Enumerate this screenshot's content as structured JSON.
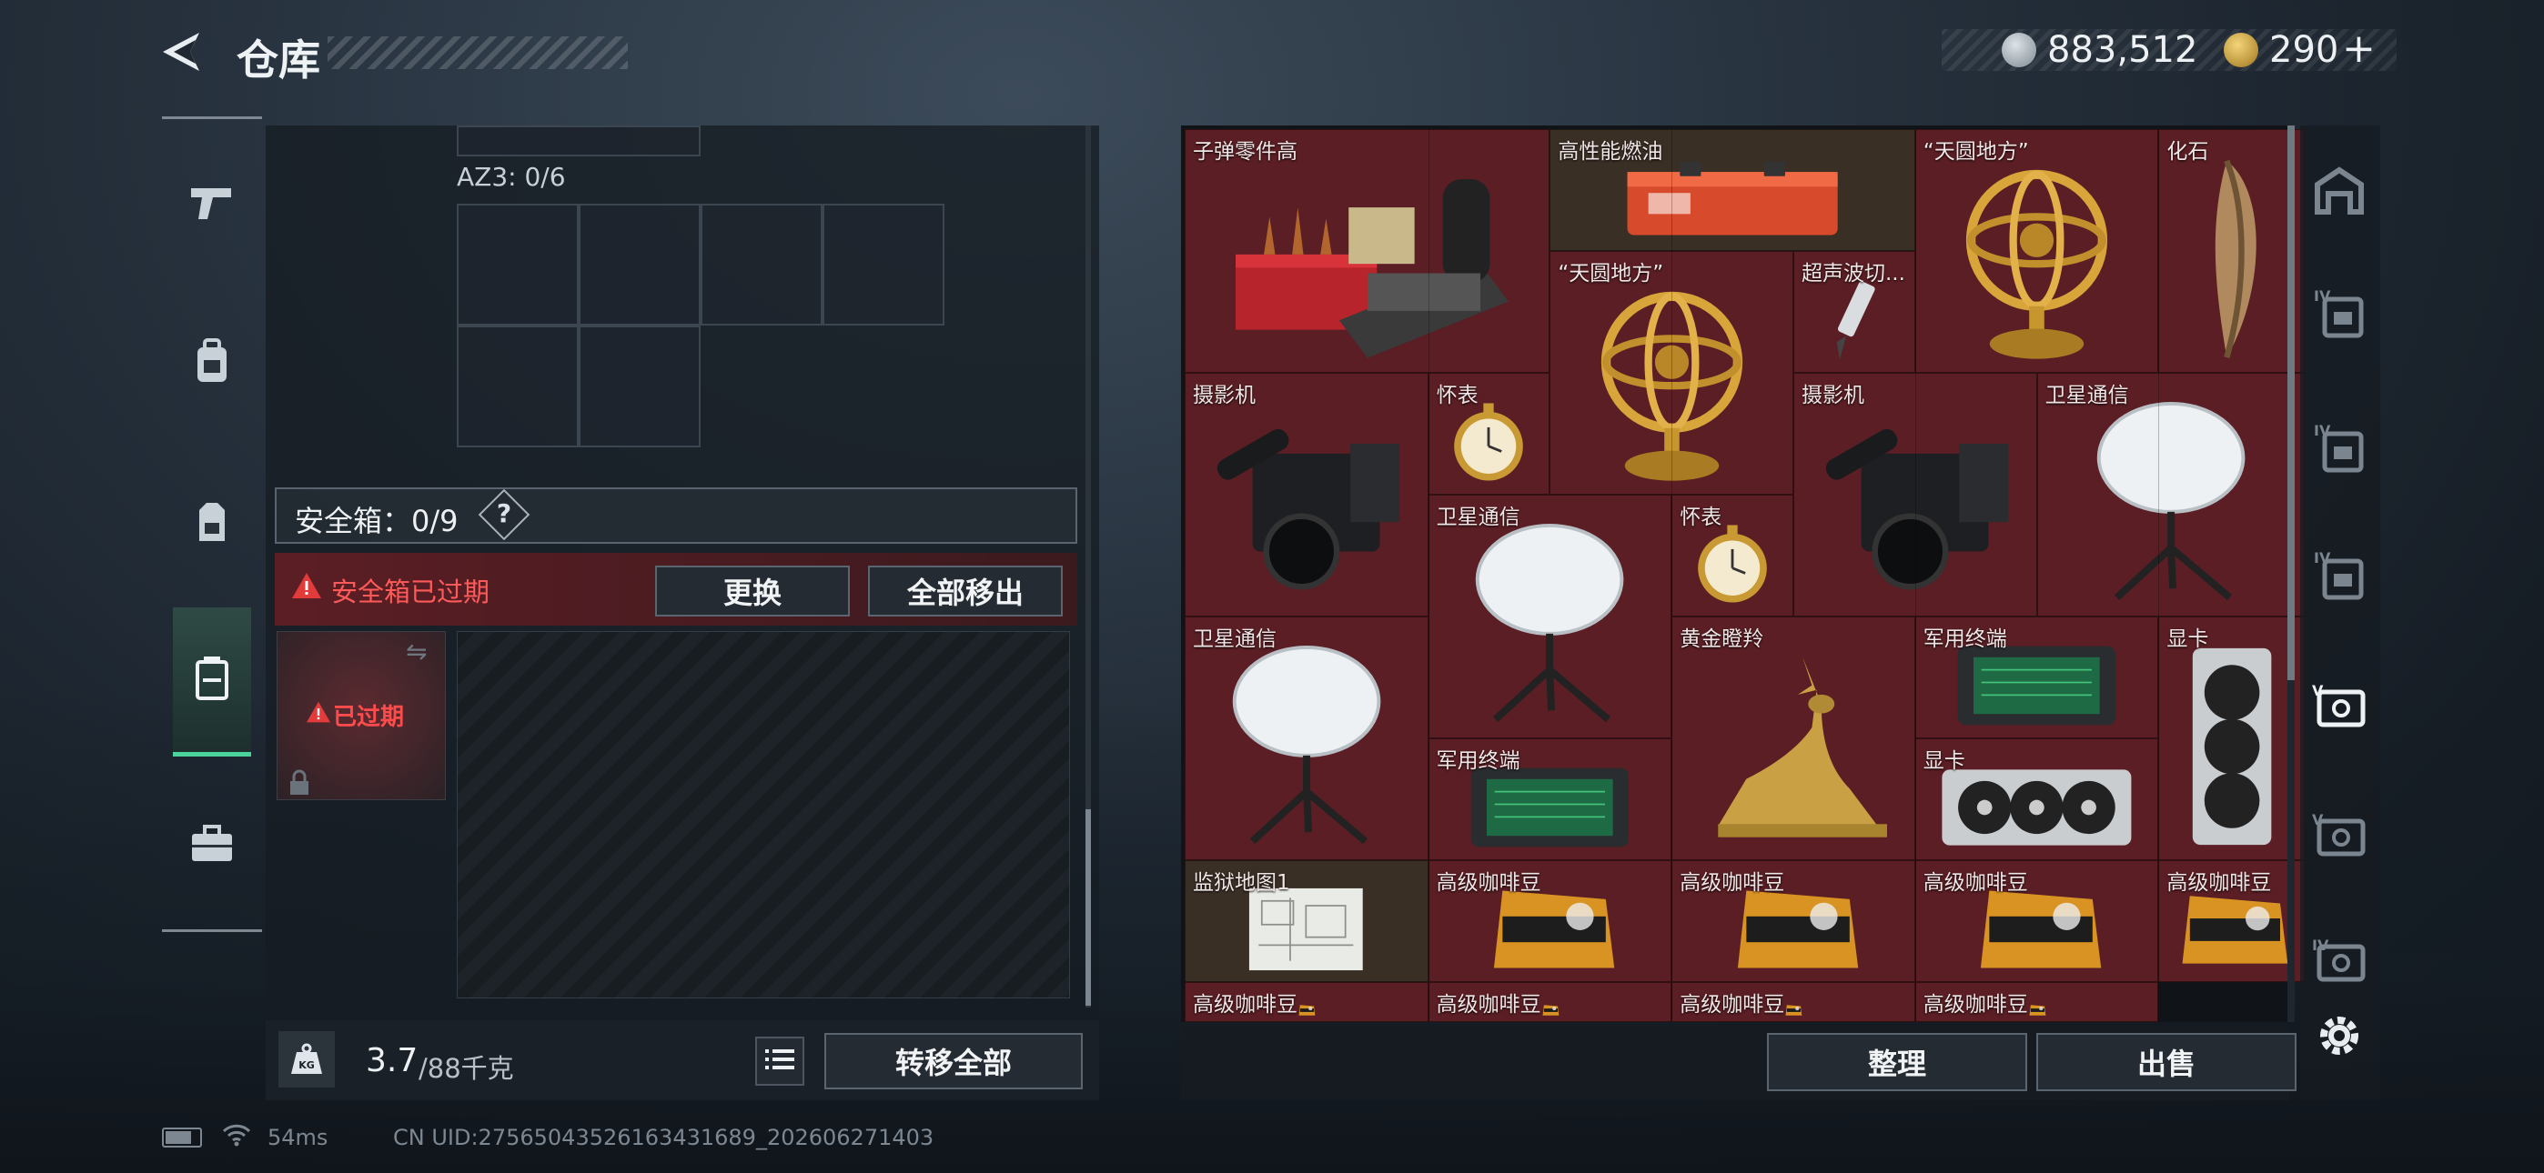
{
  "header": {
    "title": "仓库",
    "silver_amount": "883,512",
    "gold_amount": "290",
    "add_symbol": "+"
  },
  "left_nav": {
    "items": [
      "pistol-icon",
      "backpack-icon",
      "chest-rig-icon",
      "safe-box-icon",
      "toolbox-icon"
    ],
    "active": "safe-box-icon"
  },
  "rig": {
    "label": "AZ3: 0/6"
  },
  "safe_box": {
    "label": "安全箱：0/9",
    "help": "?",
    "warning": "安全箱已过期",
    "replace_label": "更换",
    "move_all_label": "全部移出",
    "expired_label": "已过期"
  },
  "weight": {
    "value": "3.7",
    "capacity": "/88千克"
  },
  "bottom_left": {
    "transfer_all_label": "转移全部"
  },
  "bottom_right": {
    "sort_label": "整理",
    "sell_label": "出售"
  },
  "status": {
    "ping": "54ms",
    "uid": "CN UID:275650435261634316​89_202606271403"
  },
  "items": [
    {
      "name": "子弹零件高"
    },
    {
      "name": "高性能燃油"
    },
    {
      "name": "“天圆地方”"
    },
    {
      "name": "化石"
    },
    {
      "name": "“天圆地方”"
    },
    {
      "name": "超声波切..."
    },
    {
      "name": "摄影机"
    },
    {
      "name": "怀表"
    },
    {
      "name": "摄影机"
    },
    {
      "name": "卫星通信"
    },
    {
      "name": "卫星通信"
    },
    {
      "name": "怀表"
    },
    {
      "name": "卫星通信"
    },
    {
      "name": "黄金瞪羚"
    },
    {
      "name": "军用终端"
    },
    {
      "name": "显卡"
    },
    {
      "name": "军用终端"
    },
    {
      "name": "显卡"
    },
    {
      "name": "监狱地图1"
    },
    {
      "name": "高级咖啡豆"
    },
    {
      "name": "高级咖啡豆"
    },
    {
      "name": "高级咖啡豆"
    },
    {
      "name": "高级咖啡豆"
    },
    {
      "name": "高级咖啡豆"
    },
    {
      "name": "高级咖啡豆"
    },
    {
      "name": "高级咖啡豆"
    },
    {
      "name": "高级咖啡豆"
    }
  ],
  "right_tabs": [
    "vault-icon",
    "level-iv-backpack-icon",
    "level-iv-backpack-icon",
    "level-iv-backpack-icon",
    "level-v-safe-icon",
    "level-v-safe-icon",
    "level-iv-safe-icon"
  ],
  "colors": {
    "accent": "#4ad39b",
    "item_bg": "#5a1e24",
    "warning": "#e23b3b"
  }
}
